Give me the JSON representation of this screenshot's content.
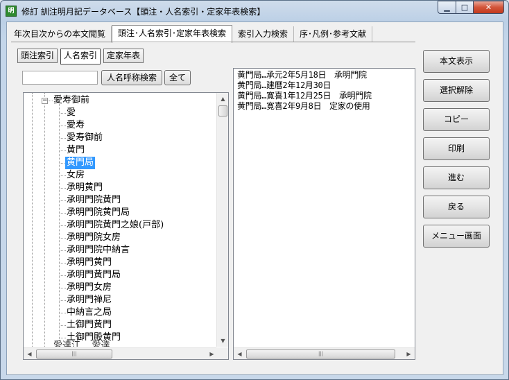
{
  "window": {
    "title": "修訂 訓注明月記データベース【頭注・人名索引・定家年表検索】",
    "icon_label": "明",
    "min_glyph": "▁",
    "max_glyph": "□",
    "close_glyph": "✕"
  },
  "tabs": [
    {
      "label": "年次目次からの本文閲覧",
      "active": false
    },
    {
      "label": "頭注･人名索引･定家年表検索",
      "active": true
    },
    {
      "label": "索引入力検索",
      "active": false
    },
    {
      "label": "序･凡例･参考文献",
      "active": false
    }
  ],
  "subtabs": [
    {
      "label": "頭注索引",
      "active": false
    },
    {
      "label": "人名索引",
      "active": true
    },
    {
      "label": "定家年表",
      "active": false
    }
  ],
  "search": {
    "value": "",
    "name_search_label": "人名呼称検索",
    "all_label": "全て"
  },
  "tree": {
    "root": {
      "label": "愛寿御前",
      "expander": "−"
    },
    "children": [
      "愛",
      "愛寿",
      "愛寿御前",
      "黄門",
      "黄門局",
      "女房",
      "承明黄門",
      "承明門院黄門",
      "承明門院黄門局",
      "承明門院黄門之娘(戸部)",
      "承明門院女房",
      "承明門院中納言",
      "承明門黄門",
      "承明門黄門局",
      "承明門女房",
      "承明門禅尼",
      "中納言之局",
      "土御門黄門",
      "土御門殿黄門"
    ],
    "selected_index": 4,
    "next_root_partial": "愛達江... 愛達",
    "scroll": {
      "up": "▲",
      "down": "▼",
      "left": "◀",
      "right": "▶",
      "grip": "|||"
    }
  },
  "results": [
    "黄門局…承元2年5月18日　承明門院",
    "黄門局…建暦2年12月30日",
    "黄門局…寛喜1年12月25日　承明門院",
    "黄門局…寛喜2年9月8日　定家の使用"
  ],
  "side_buttons": [
    {
      "label": "本文表示"
    },
    {
      "label": "選択解除"
    },
    {
      "label": "コピー"
    },
    {
      "label": "印刷"
    },
    {
      "label": "進む"
    },
    {
      "label": "戻る"
    },
    {
      "label": "メニュー画面"
    }
  ],
  "colors": {
    "selection": "#3399ff",
    "window_frame": "#c4d6ea",
    "close_button": "#c23a1e"
  }
}
